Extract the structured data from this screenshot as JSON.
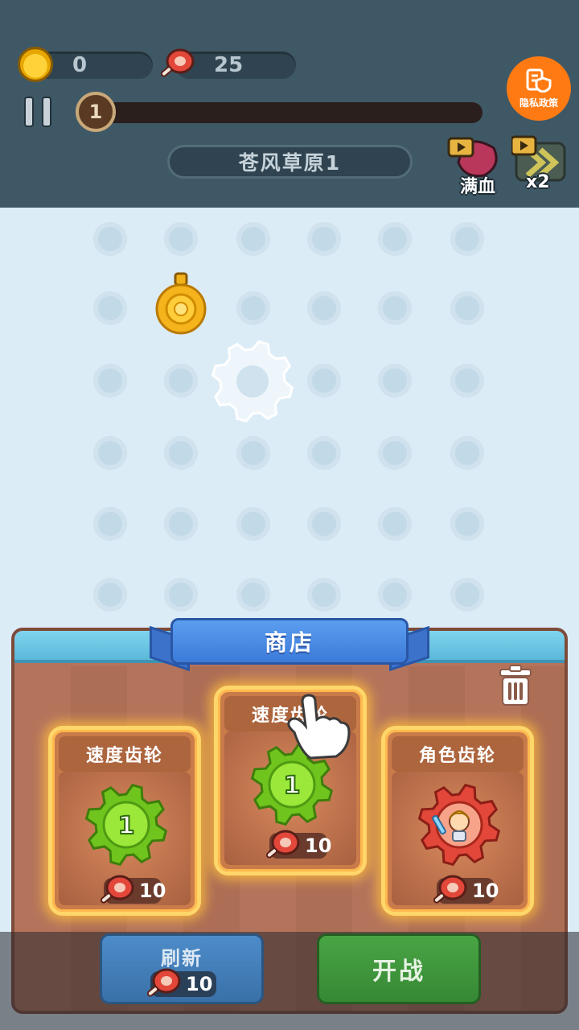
{
  "hud": {
    "coins": "0",
    "meat": "25",
    "level": "1",
    "stage_name": "苍风草原1",
    "privacy_label": "隐私政策",
    "boost_heal_label": "满血",
    "boost_speed_label": "x2",
    "progress": 0
  },
  "shop": {
    "title": "商店",
    "cards": [
      {
        "title": "速度齿轮",
        "level": "1",
        "price": "10",
        "kind": "speed-gear"
      },
      {
        "title": "速度齿轮",
        "level": "1",
        "price": "10",
        "kind": "speed-gear"
      },
      {
        "title": "角色齿轮",
        "level": "",
        "price": "10",
        "kind": "character-gear"
      }
    ],
    "refresh_label": "刷新",
    "refresh_price": "10",
    "start_label": "开战"
  },
  "colors": {
    "hud_bg": "#3f5866",
    "board_bg": "#dcecf7",
    "accent_orange": "#ff7a12",
    "speed_gear_green": "#7ed321",
    "character_gear_red": "#e2473a",
    "card_glow": "#ffd66a"
  }
}
